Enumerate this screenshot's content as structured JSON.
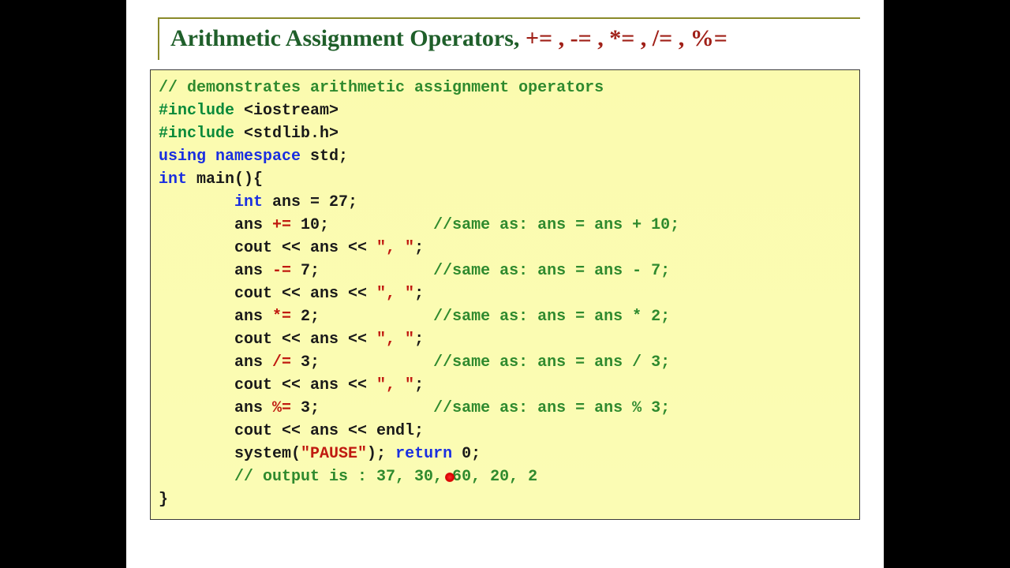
{
  "title": {
    "label": "Arithmetic Assignment Operators, ",
    "ops": "+= , -= , *= , /= , %="
  },
  "code": {
    "l1_cmt": "// demonstrates arithmetic assignment operators",
    "l2_pre": "#include ",
    "l2_hdr": "<iostream>",
    "l3_pre": "#include ",
    "l3_hdr": "<stdlib.h>",
    "l4_kw1": "using ",
    "l4_kw2": "namespace ",
    "l4_txt": "std;",
    "l5_kw": "int ",
    "l5_txt": "main(){",
    "l6_kw": "int ",
    "l6_txt": "ans = 27;",
    "l7_a": "ans ",
    "l7_op": "+=",
    "l7_b": " 10;",
    "l7_cmt": "//same as: ans = ans + 10;",
    "l8_txt": "cout << ans << ",
    "l8_str": "\", \"",
    "l8_end": ";",
    "l9_a": "ans ",
    "l9_op": "-=",
    "l9_b": " 7;",
    "l9_cmt": "//same as: ans = ans - 7;",
    "l10_txt": "cout << ans << ",
    "l10_str": "\", \"",
    "l10_end": ";",
    "l11_a": "ans ",
    "l11_op": "*=",
    "l11_b": " 2;",
    "l11_cmt": "//same as: ans = ans * 2;",
    "l12_txt": "cout << ans << ",
    "l12_str": "\", \"",
    "l12_end": ";",
    "l13_a": "ans ",
    "l13_op": "/=",
    "l13_b": " 3;",
    "l13_cmt": "//same as: ans = ans / 3;",
    "l14_txt": "cout << ans << ",
    "l14_str": "\", \"",
    "l14_end": ";",
    "l15_a": "ans ",
    "l15_op": "%=",
    "l15_b": " 3;",
    "l15_cmt": "//same as: ans = ans % 3;",
    "l16_txt": "cout << ans << endl;",
    "l17_a": "system(",
    "l17_str": "\"PAUSE\"",
    "l17_b": "); ",
    "l17_kw": "return ",
    "l17_c": "0;",
    "l18_cmt": "// output is : 37, 30, 60, 20, 2",
    "l19_txt": "}"
  }
}
